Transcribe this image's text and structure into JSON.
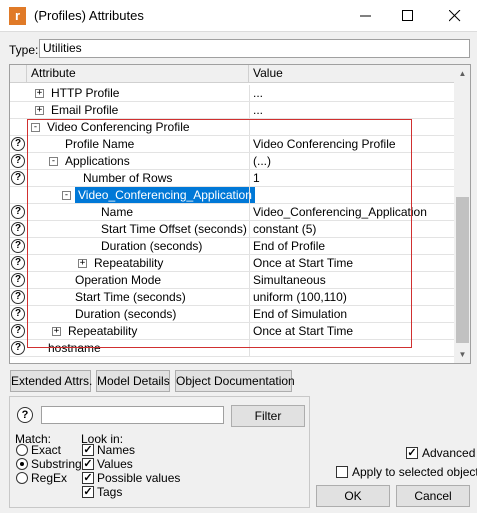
{
  "window": {
    "title": "(Profiles) Attributes",
    "icon_letter": "r"
  },
  "type_field": {
    "label": "Type:",
    "value": "Utilities"
  },
  "grid": {
    "col_attribute": "Attribute",
    "col_value": "Value",
    "rows": [
      {
        "label": "HTTP Profile",
        "value": "...",
        "q": false,
        "expander": "+"
      },
      {
        "label": "Email Profile",
        "value": "...",
        "q": false,
        "expander": "+"
      },
      {
        "label": "Video Conferencing Profile",
        "value": "",
        "q": false,
        "expander": "-"
      },
      {
        "label": "Profile Name",
        "value": "Video Conferencing Profile",
        "q": true,
        "expander": ""
      },
      {
        "label": "Applications",
        "value": "(...)",
        "q": true,
        "expander": "-"
      },
      {
        "label": "Number of Rows",
        "value": "1",
        "q": true,
        "expander": ""
      },
      {
        "label": "Video_Conferencing_Application",
        "value": "",
        "q": false,
        "expander": "-",
        "selected": true
      },
      {
        "label": "Name",
        "value": "Video_Conferencing_Application",
        "q": true,
        "expander": ""
      },
      {
        "label": "Start Time Offset (seconds)",
        "value": "constant (5)",
        "q": true,
        "expander": ""
      },
      {
        "label": "Duration (seconds)",
        "value": "End of Profile",
        "q": true,
        "expander": ""
      },
      {
        "label": "Repeatability",
        "value": "Once at Start Time",
        "q": true,
        "expander": "+"
      },
      {
        "label": "Operation Mode",
        "value": "Simultaneous",
        "q": true,
        "expander": ""
      },
      {
        "label": "Start Time (seconds)",
        "value": "uniform (100,110)",
        "q": true,
        "expander": ""
      },
      {
        "label": "Duration (seconds)",
        "value": "End of Simulation",
        "q": true,
        "expander": ""
      },
      {
        "label": "Repeatability",
        "value": "Once at Start Time",
        "q": true,
        "expander": "+"
      },
      {
        "label": "hostname",
        "value": "",
        "q": true,
        "expander": ""
      }
    ]
  },
  "buttons": {
    "extended": "Extended Attrs.",
    "model": "Model Details",
    "objdoc": "Object Documentation",
    "filter": "Filter",
    "ok": "OK",
    "cancel": "Cancel"
  },
  "filter": {
    "match_label": "Match:",
    "match_options": [
      "Exact",
      "Substring",
      "RegEx"
    ],
    "match_selected": "Substring",
    "lookin_label": "Look in:",
    "lookin_options": [
      "Names",
      "Values",
      "Possible values",
      "Tags"
    ]
  },
  "options": {
    "advanced": "Advanced",
    "apply_selected": "Apply to selected objects"
  },
  "colors": {
    "selection": "#0078d7",
    "highlight_box": "#d03030",
    "app_icon": "#e07a28"
  }
}
